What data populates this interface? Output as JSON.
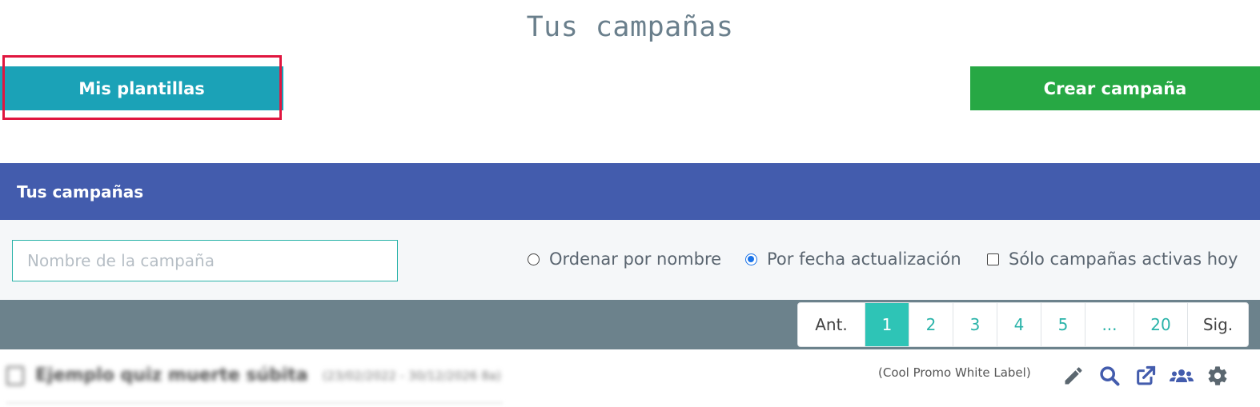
{
  "page": {
    "title": "Tus campañas"
  },
  "buttons": {
    "templates_label": "Mis plantillas",
    "create_label": "Crear campaña"
  },
  "card": {
    "header_title": "Tus campañas"
  },
  "filters": {
    "search_placeholder": "Nombre de la campaña",
    "search_value": "",
    "order_by_name_label": "Ordenar por nombre",
    "order_by_date_label": "Por fecha actualización",
    "active_today_label": "Sólo campañas activas hoy",
    "selected_order": "Por fecha actualización",
    "active_today_checked": false
  },
  "pagination": {
    "prev_label": "Ant.",
    "next_label": "Sig.",
    "pages": [
      "1",
      "2",
      "3",
      "4",
      "5",
      "...",
      "20"
    ],
    "current": "1"
  },
  "campaign_row": {
    "name": "Ejemplo quiz muerte súbita",
    "dates": "(23/02/2022 - 30/12/2026 8a)",
    "tag": "(Cool Promo White Label)",
    "actions": [
      "pencil-icon",
      "search-icon",
      "external-link-icon",
      "users-icon",
      "gear-icon"
    ]
  },
  "colors": {
    "templates_button": "#1ba2b7",
    "create_button": "#27a844",
    "header": "#435cad",
    "pager_bar": "#6c828c",
    "active_page": "#2ec4b6",
    "highlight": "#e0163f",
    "action_icons": "#435cad"
  }
}
